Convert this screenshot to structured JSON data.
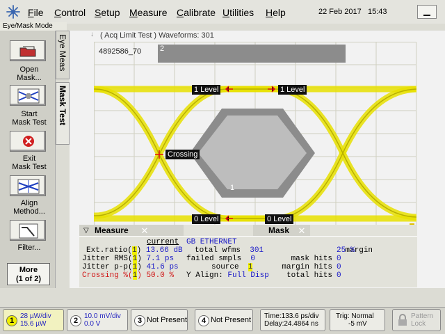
{
  "menu": {
    "items": [
      {
        "label_u": "F",
        "label_rest": "ile"
      },
      {
        "label_u": "C",
        "label_rest": "ontrol"
      },
      {
        "label_u": "S",
        "label_rest": "etup"
      },
      {
        "label_u": "M",
        "label_rest": "easure"
      },
      {
        "label_u": "C",
        "label_rest": "alibrate"
      },
      {
        "label_u": "U",
        "label_rest": "tilities"
      },
      {
        "label_u": "H",
        "label_rest": "elp"
      }
    ],
    "date": "22 Feb 2017",
    "time": "15:43"
  },
  "mode_label": "Eye/Mask Mode",
  "tools": [
    {
      "label": "Open\nMask...",
      "icon": "open-folder-icon"
    },
    {
      "label": "Start\nMask Test",
      "icon": "mask-start-icon"
    },
    {
      "label": "Exit\nMask Test",
      "icon": "exit-icon"
    },
    {
      "label": "Align\nMethod...",
      "icon": "align-icon"
    },
    {
      "label": "Filter...",
      "icon": "filter-icon"
    }
  ],
  "more_button": {
    "line1": "More",
    "line2": "(1 of 2)"
  },
  "tabs": {
    "eye": "Eye Meas",
    "mask": "Mask Test"
  },
  "screen": {
    "acq_text": "( Acq Limit Test )  Waveforms: 301",
    "pattern_id": "4892586_70",
    "region_top": "2",
    "region_bottom": "1",
    "level_label": "1 Level",
    "zero_label": "0 Level",
    "crossing_label": "Crossing"
  },
  "measure_panel": {
    "title": "Measure",
    "current_header": "current",
    "rows": [
      {
        "name": "Ext.ratio(",
        "chan": "1",
        "close": ")",
        "value": "13.66 dB",
        "red": false
      },
      {
        "name": "Jitter RMS(",
        "chan": "1",
        "close": ")",
        "value": "7.1 ps",
        "red": false
      },
      {
        "name": "Jitter p-p(",
        "chan": "1",
        "close": ")",
        "value": "41.6 ps",
        "red": false
      },
      {
        "name": "Crossing %(",
        "chan": "1",
        "close": ")",
        "value": "50.0 %",
        "red": true
      }
    ]
  },
  "mask_panel": {
    "title": "Mask",
    "standard": "GB ETHERNET",
    "left_rows": [
      {
        "label": "total wfms",
        "value": "301"
      },
      {
        "label": "failed smpls",
        "value": "0"
      },
      {
        "label": "source",
        "value": "1"
      }
    ],
    "align_label": "Y Align:",
    "align_value": "Full Disp",
    "right_rows": [
      {
        "label": "margin",
        "value": "25 %"
      },
      {
        "label": "mask hits",
        "value": "0"
      },
      {
        "label": "margin hits",
        "value": "0"
      },
      {
        "label": "total hits",
        "value": "0"
      }
    ]
  },
  "bottom": {
    "ch1": {
      "num": "1",
      "line1": "28 µW/div",
      "line2": "15.6 µW"
    },
    "ch2": {
      "num": "2",
      "line1": "10.0 mV/div",
      "line2": "0.0 V"
    },
    "ch3": {
      "num": "3",
      "line1": "Not Present"
    },
    "ch4": {
      "num": "4",
      "line1": "Not Present"
    },
    "time": {
      "line1": "Time:133.6 ps/div",
      "line2": "Delay:24.4864 ns"
    },
    "trig": {
      "line1": "Trig: Normal",
      "line2": "-5 mV"
    },
    "lock": {
      "line1": "Pattern",
      "line2": "Lock"
    }
  },
  "colors": {
    "trace": "#e8e000",
    "mask": "#8c8c8c",
    "grid": "#d8d8c8",
    "accent_blue": "#1818c8",
    "measure_red": "#d01818"
  }
}
